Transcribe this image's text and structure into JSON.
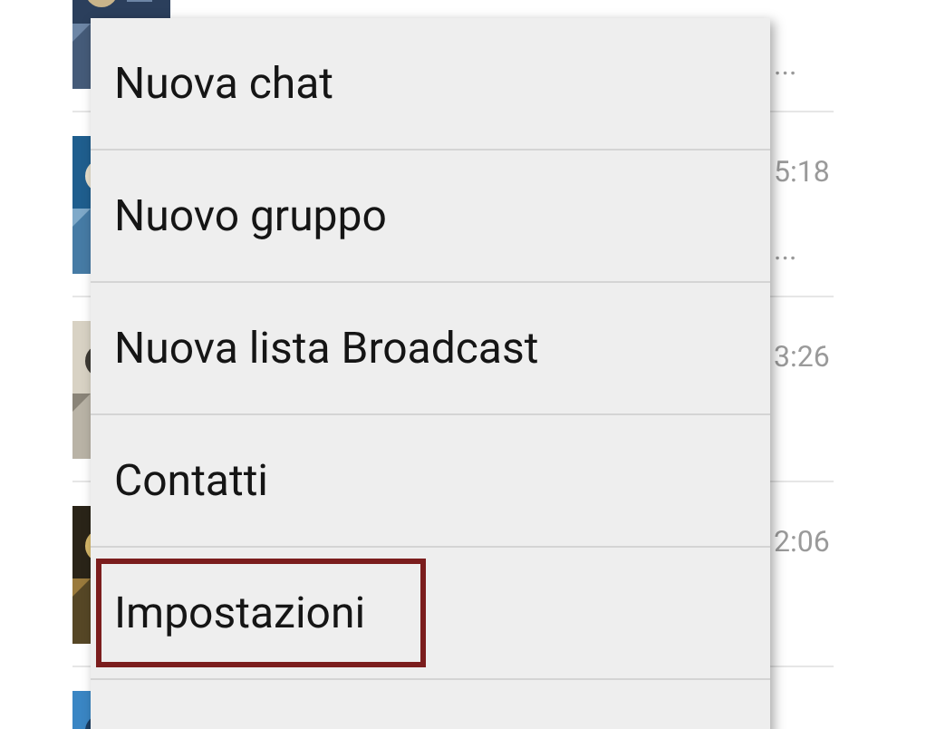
{
  "chats": [
    {
      "kind": "picture",
      "preview": "..."
    },
    {
      "kind": "picture",
      "time": "5:18",
      "preview": "..."
    },
    {
      "kind": "picture",
      "time": "3:26"
    },
    {
      "kind": "picture",
      "time": "2:06"
    },
    {
      "kind": "picture"
    }
  ],
  "menu": {
    "items": [
      {
        "label": "Nuova chat",
        "highlighted": false
      },
      {
        "label": "Nuovo gruppo",
        "highlighted": false
      },
      {
        "label": "Nuova lista Broadcast",
        "highlighted": false
      },
      {
        "label": "Contatti",
        "highlighted": false
      },
      {
        "label": "Impostazioni",
        "highlighted": true
      }
    ]
  }
}
